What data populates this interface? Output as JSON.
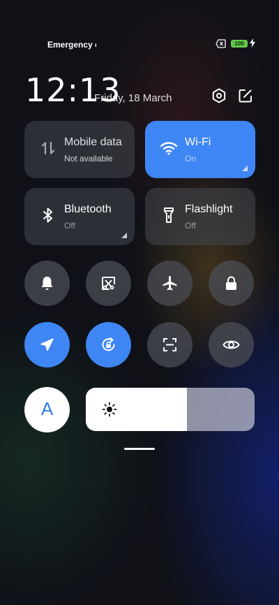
{
  "status_bar": {
    "carrier": "Emergency c",
    "battery_level": "100",
    "battery_color": "#5ec445"
  },
  "header": {
    "time": "12:13",
    "date": "Friday, 18 March",
    "settings_icon": "hexagon-gear-icon",
    "edit_icon": "edit-icon"
  },
  "tiles": [
    {
      "label": "Mobile data",
      "sub": "Not available",
      "icon": "mobile-data-icon",
      "on": false
    },
    {
      "label": "Wi-Fi",
      "sub": "On",
      "icon": "wifi-icon",
      "on": true
    },
    {
      "label": "Bluetooth",
      "sub": "Off",
      "icon": "bluetooth-icon",
      "on": false
    },
    {
      "label": "Flashlight",
      "sub": "Off",
      "icon": "flashlight-icon",
      "on": false
    }
  ],
  "toggles": [
    {
      "icon": "bell-icon",
      "on": false
    },
    {
      "icon": "screenshot-icon",
      "on": false
    },
    {
      "icon": "airplane-icon",
      "on": false
    },
    {
      "icon": "lock-icon",
      "on": false
    },
    {
      "icon": "location-icon",
      "on": true
    },
    {
      "icon": "rotation-lock-icon",
      "on": true
    },
    {
      "icon": "scanner-icon",
      "on": false
    },
    {
      "icon": "eye-icon",
      "on": false
    }
  ],
  "brightness": {
    "auto_label": "A",
    "level_fraction": 0.6
  },
  "colors": {
    "accent": "#3f86f5",
    "tile_bg": "#46484f"
  }
}
